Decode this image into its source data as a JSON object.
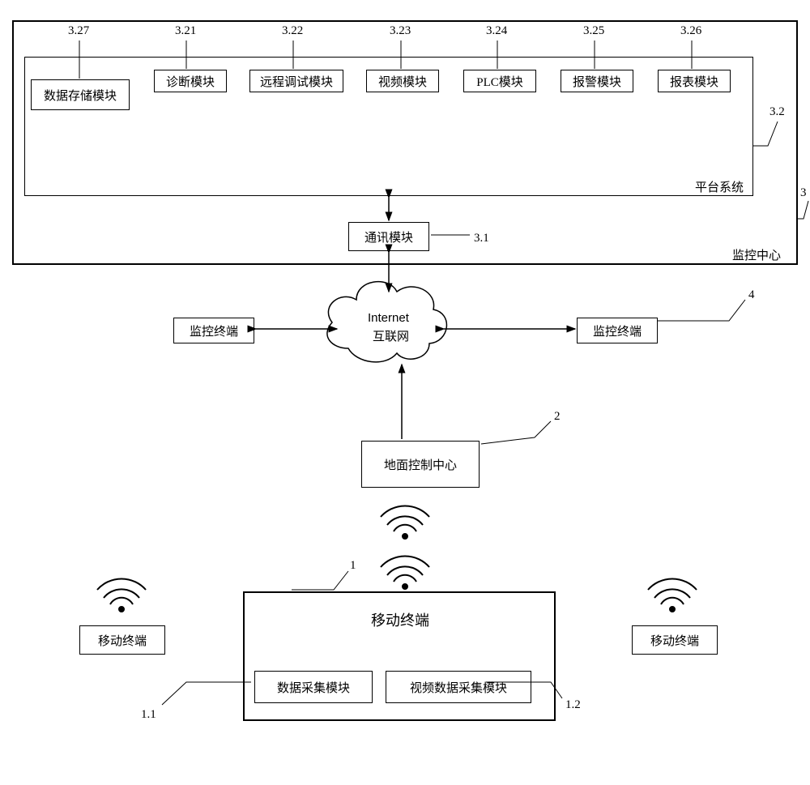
{
  "nums": {
    "n327": "3.27",
    "n321": "3.21",
    "n322": "3.22",
    "n323": "3.23",
    "n324": "3.24",
    "n325": "3.25",
    "n326": "3.26",
    "n32": "3.2",
    "n3": "3",
    "n31": "3.1",
    "n4": "4",
    "n2": "2",
    "n1": "1",
    "n11": "1.1",
    "n12": "1.2"
  },
  "labels": {
    "monitoring_center": "监控中心",
    "platform_system": "平台系统",
    "data_storage": "数据存储模块",
    "diagnosis": "诊断模块",
    "remote_debug": "远程调试模块",
    "video": "视频模块",
    "plc": "PLC模块",
    "alarm": "报警模块",
    "report": "报表模块",
    "comm": "通讯模块",
    "internet1": "Internet",
    "internet2": "互联网",
    "monitor_terminal": "监控终端",
    "ground_control": "地面控制中心",
    "mobile_terminal": "移动终端",
    "data_collect": "数据采集模块",
    "video_collect": "视频数据采集模块"
  }
}
